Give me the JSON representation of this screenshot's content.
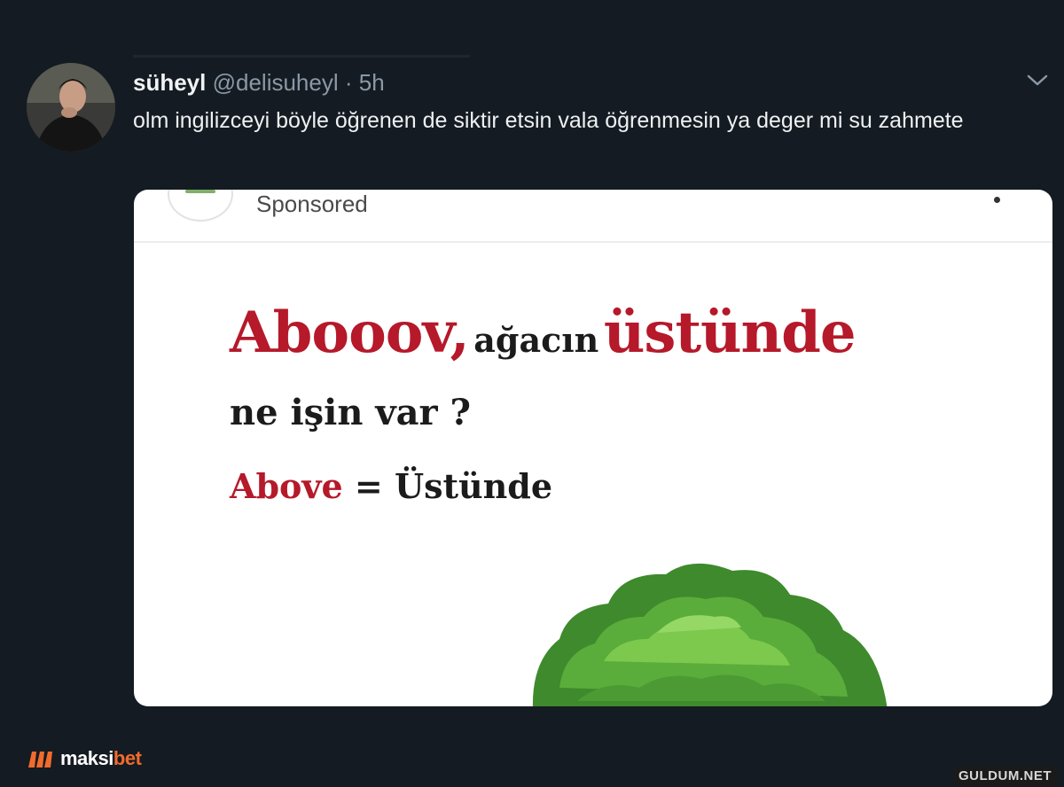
{
  "tweet": {
    "author_name": "süheyl",
    "handle": "@delisuheyl",
    "separator": "·",
    "time": "5h",
    "text": "olm ingilizceyi böyle öğrenen de siktir etsin vala öğrenmesin ya deger mi su zahmete"
  },
  "card": {
    "sponsored_label": "Sponsored",
    "headline_word1": "Abooov,",
    "headline_word2": "ağacın",
    "headline_word3": "üstünde",
    "line2": "ne işin var ?",
    "line3_word": "Above",
    "line3_equals": "=",
    "line3_translation": "Üstünde"
  },
  "branding": {
    "logo_text_main": "maksi",
    "logo_text_accent": "bet",
    "watermark": "GULDUM.NET"
  },
  "colors": {
    "background": "#141b22",
    "headline_red": "#b5192a",
    "brand_orange": "#f26b2c"
  },
  "icons": {
    "menu": "chevron-down-icon",
    "card_more": "more-dot-icon"
  }
}
